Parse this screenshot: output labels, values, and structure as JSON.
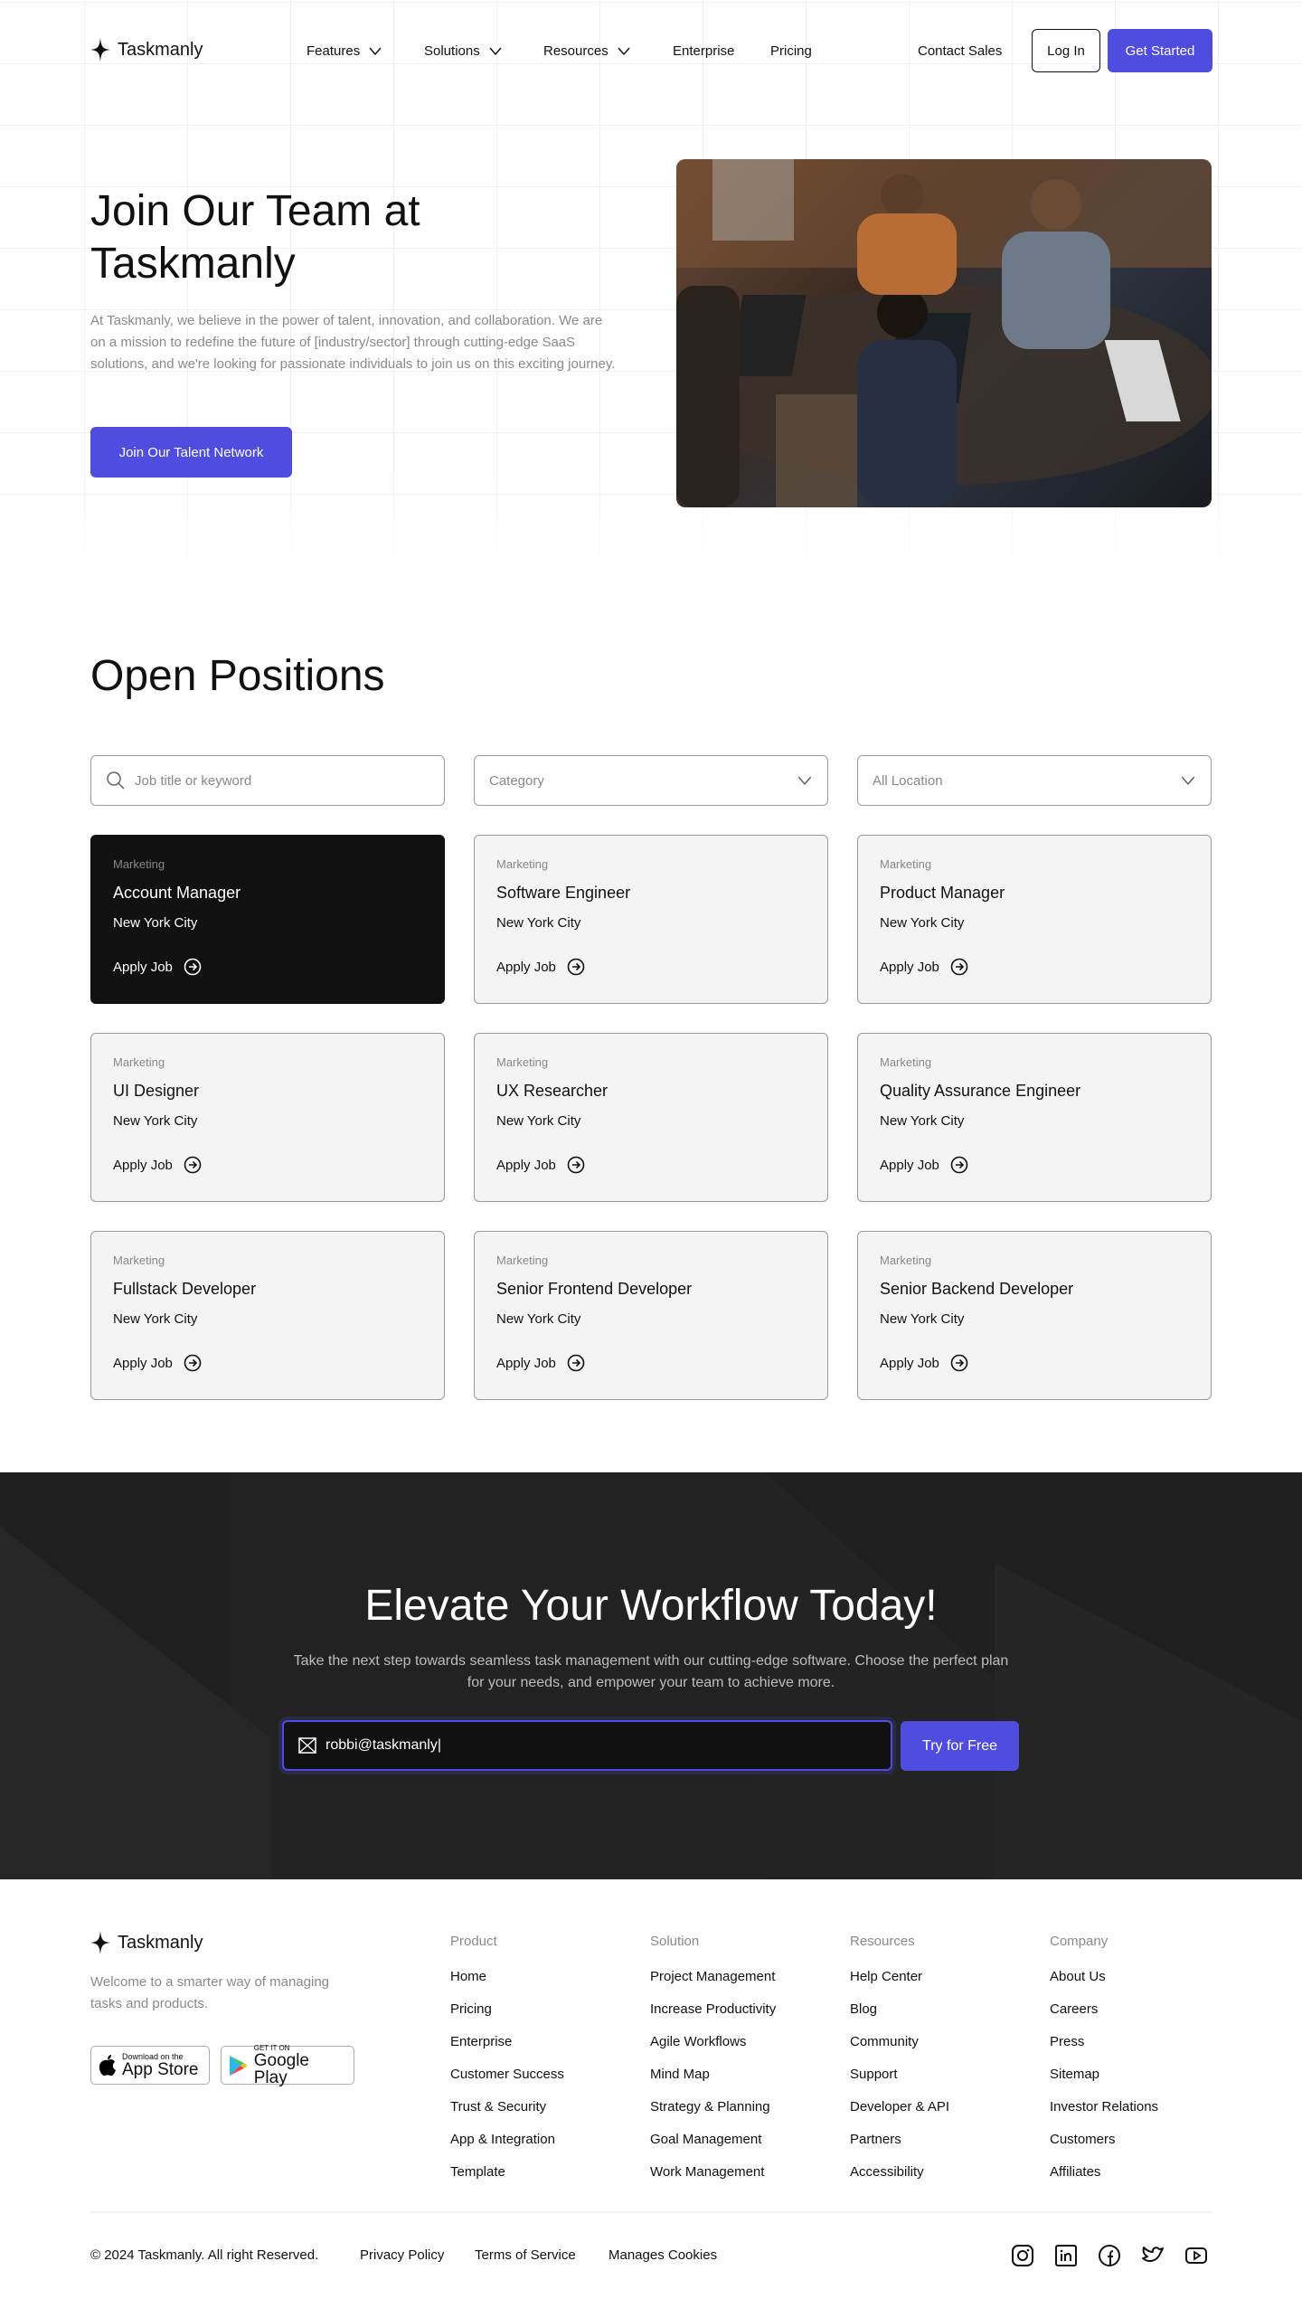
{
  "brand": "Taskmanly",
  "nav": {
    "items": [
      {
        "label": "Features",
        "dropdown": true
      },
      {
        "label": "Solutions",
        "dropdown": true
      },
      {
        "label": "Resources",
        "dropdown": true
      },
      {
        "label": "Enterprise",
        "dropdown": false
      },
      {
        "label": "Pricing",
        "dropdown": false
      }
    ],
    "contact": "Contact Sales",
    "login": "Log In",
    "get_started": "Get Started"
  },
  "hero": {
    "title": "Join Our Team at Taskmanly",
    "paragraph": "At Taskmanly, we believe in the power of talent, innovation, and collaboration. We are on a mission to redefine the future of [industry/sector] through cutting-edge SaaS solutions, and we're looking for passionate individuals to join us on this exciting journey.",
    "cta": "Join Our Talent Network"
  },
  "positions": {
    "title": "Open Positions",
    "search_placeholder": "Job title or keyword",
    "category_placeholder": "Category",
    "location_placeholder": "All Location",
    "apply_label": "Apply Job",
    "jobs": [
      {
        "category": "Marketing",
        "title": "Account Manager",
        "location": "New York City",
        "active": true
      },
      {
        "category": "Marketing",
        "title": "Software Engineer",
        "location": "New York City"
      },
      {
        "category": "Marketing",
        "title": "Product Manager",
        "location": "New York City"
      },
      {
        "category": "Marketing",
        "title": "UI Designer",
        "location": "New York City"
      },
      {
        "category": "Marketing",
        "title": "UX Researcher",
        "location": "New York City"
      },
      {
        "category": "Marketing",
        "title": "Quality Assurance Engineer",
        "location": "New York City"
      },
      {
        "category": "Marketing",
        "title": "Fullstack Developer",
        "location": "New York City"
      },
      {
        "category": "Marketing",
        "title": "Senior Frontend Developer",
        "location": "New York City"
      },
      {
        "category": "Marketing",
        "title": "Senior Backend Developer",
        "location": "New York City"
      }
    ]
  },
  "cta": {
    "title": "Elevate Your Workflow Today!",
    "paragraph": "Take the next step towards seamless task management with our cutting-edge software. Choose the perfect plan for your needs, and empower your team to achieve more.",
    "email_value": "robbi@taskmanly",
    "button": "Try for Free"
  },
  "footer": {
    "tagline": "Welcome to a smarter way of managing tasks and products.",
    "app_store": {
      "small": "Download on the",
      "big": "App Store"
    },
    "google_play": {
      "small": "GET IT ON",
      "big": "Google Play"
    },
    "columns": [
      {
        "heading": "Product",
        "items": [
          "Home",
          "Pricing",
          "Enterprise",
          "Customer Success",
          "Trust & Security",
          "App & Integration",
          "Template"
        ]
      },
      {
        "heading": "Solution",
        "items": [
          "Project Management",
          "Increase Productivity",
          "Agile Workflows",
          "Mind Map",
          "Strategy & Planning",
          "Goal Management",
          "Work Management"
        ]
      },
      {
        "heading": "Resources",
        "items": [
          "Help Center",
          "Blog",
          "Community",
          "Support",
          "Developer & API",
          "Partners",
          "Accessibility"
        ]
      },
      {
        "heading": "Company",
        "items": [
          "About Us",
          "Careers",
          "Press",
          "Sitemap",
          "Investor Relations",
          "Customers",
          "Affiliates"
        ]
      }
    ],
    "copyright": "© 2024 Taskmanly. All right Reserved.",
    "links": [
      "Privacy Policy",
      "Terms of Service",
      "Manages Cookies"
    ],
    "social": [
      "instagram",
      "linkedin",
      "facebook",
      "twitter",
      "youtube"
    ]
  },
  "colors": {
    "accent": "#4f4ddf",
    "dark": "#111111",
    "cta_bg": "#1f1f1f"
  }
}
